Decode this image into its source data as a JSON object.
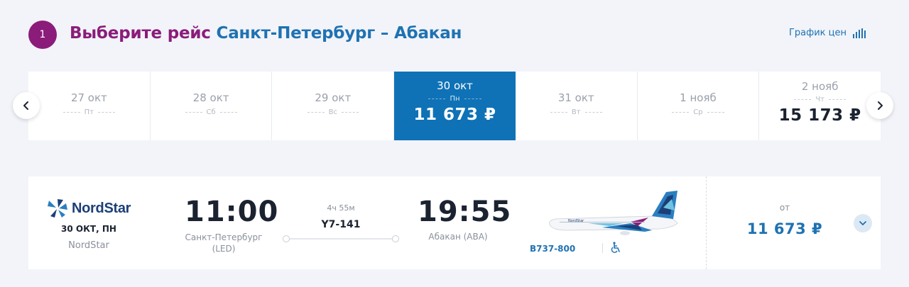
{
  "header": {
    "step_number": "1",
    "title_prefix": "Выберите рейс",
    "title_route": "Санкт-Петербург – Абакан",
    "price_chart_label": "График цен"
  },
  "dates": [
    {
      "date": "27 окт",
      "weekday": "Пт",
      "price": ""
    },
    {
      "date": "28 окт",
      "weekday": "Сб",
      "price": ""
    },
    {
      "date": "29 окт",
      "weekday": "Вс",
      "price": ""
    },
    {
      "date": "30 окт",
      "weekday": "Пн",
      "price": "11 673 ₽"
    },
    {
      "date": "31 окт",
      "weekday": "Вт",
      "price": ""
    },
    {
      "date": "1 нояб",
      "weekday": "Ср",
      "price": ""
    },
    {
      "date": "2 нояб",
      "weekday": "Чт",
      "price": "15 173 ₽"
    }
  ],
  "flight": {
    "airline_logo_text": "NordStar",
    "date": "30 ОКТ, ПН",
    "airline_name": "NordStar",
    "departure_time": "11:00",
    "departure_city": "Санкт-Петербург (LED)",
    "duration": "4ч 55м",
    "flight_number": "Y7-141",
    "arrival_time": "19:55",
    "arrival_city": "Абакан (ABA)",
    "aircraft": "B737-800",
    "price_prefix": "от",
    "price": "11 673 ₽"
  },
  "icons": {
    "prev": "chevron-left-icon",
    "next": "chevron-right-icon",
    "chart": "bar-chart-icon",
    "expand": "chevron-down-icon",
    "accessibility": "wheelchair-icon"
  },
  "colors": {
    "accent_purple": "#8b1c7a",
    "accent_blue": "#1f72b2",
    "selected_bg": "#0f72b6"
  }
}
